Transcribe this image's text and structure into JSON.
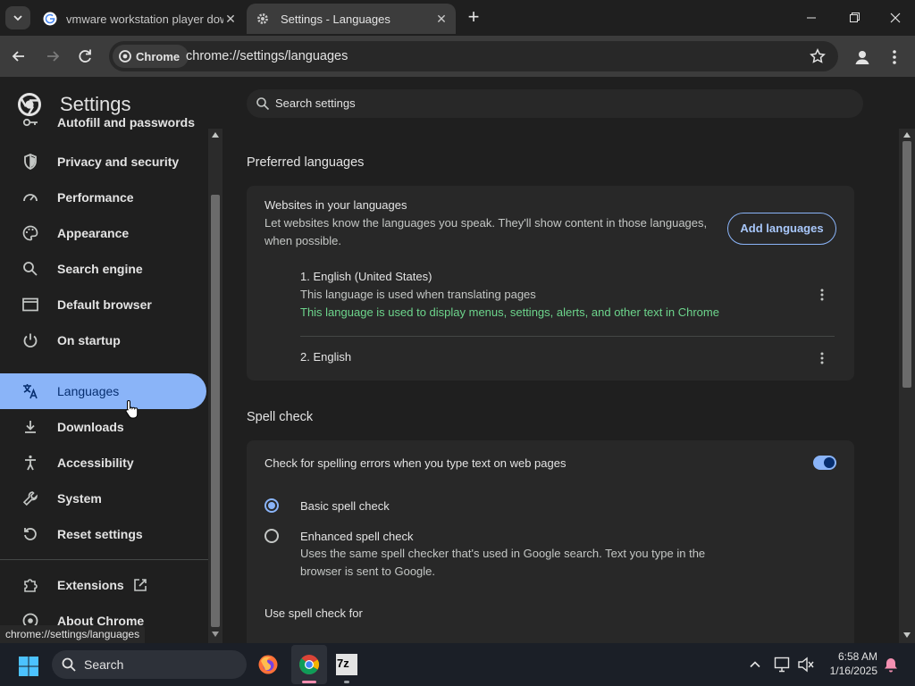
{
  "browser": {
    "tabs": [
      {
        "title": "vmware workstation player dow",
        "favicon": "google-icon",
        "close": "✕"
      },
      {
        "title": "Settings - Languages",
        "favicon": "gear-icon",
        "close": "✕"
      }
    ],
    "new_tab": "+",
    "omnibox": {
      "chip_label": "Chrome",
      "url": "chrome://settings/languages"
    },
    "status_url": "chrome://settings/languages"
  },
  "settings": {
    "title": "Settings",
    "search_placeholder": "Search settings",
    "nav": {
      "autofill": "Autofill and passwords",
      "privacy": "Privacy and security",
      "performance": "Performance",
      "appearance": "Appearance",
      "search_engine": "Search engine",
      "default_browser": "Default browser",
      "on_startup": "On startup",
      "languages": "Languages",
      "downloads": "Downloads",
      "accessibility": "Accessibility",
      "system": "System",
      "reset": "Reset settings",
      "extensions": "Extensions",
      "about": "About Chrome"
    },
    "selected_nav": "languages"
  },
  "preferred_languages": {
    "heading": "Preferred languages",
    "websites_title": "Websites in your languages",
    "websites_desc_line1": "Let websites know the languages you speak. They'll show content in those languages,",
    "websites_desc_line2": "when possible.",
    "add_button": "Add languages",
    "languages": [
      {
        "name": "1. English (United States)",
        "note1": "This language is used when translating pages",
        "note2": "This language is used to display menus, settings, alerts, and other text in Chrome"
      },
      {
        "name": "2. English"
      }
    ]
  },
  "spell_check": {
    "heading": "Spell check",
    "toggle_label": "Check for spelling errors when you type text on web pages",
    "toggle_on": true,
    "basic_label": "Basic spell check",
    "enhanced_label": "Enhanced spell check",
    "enhanced_desc_line1": "Uses the same spell checker that's used in Google search. Text you type in the",
    "enhanced_desc_line2": "browser is sent to Google.",
    "selected_mode": "basic",
    "use_for": "Use spell check for"
  },
  "taskbar": {
    "search_label": "Search",
    "time": "6:58 AM",
    "date": "1/16/2025"
  },
  "colors": {
    "accent": "#8ab4f8",
    "success_text": "#6dd58c",
    "toggle_on": "#8ab4f8"
  }
}
